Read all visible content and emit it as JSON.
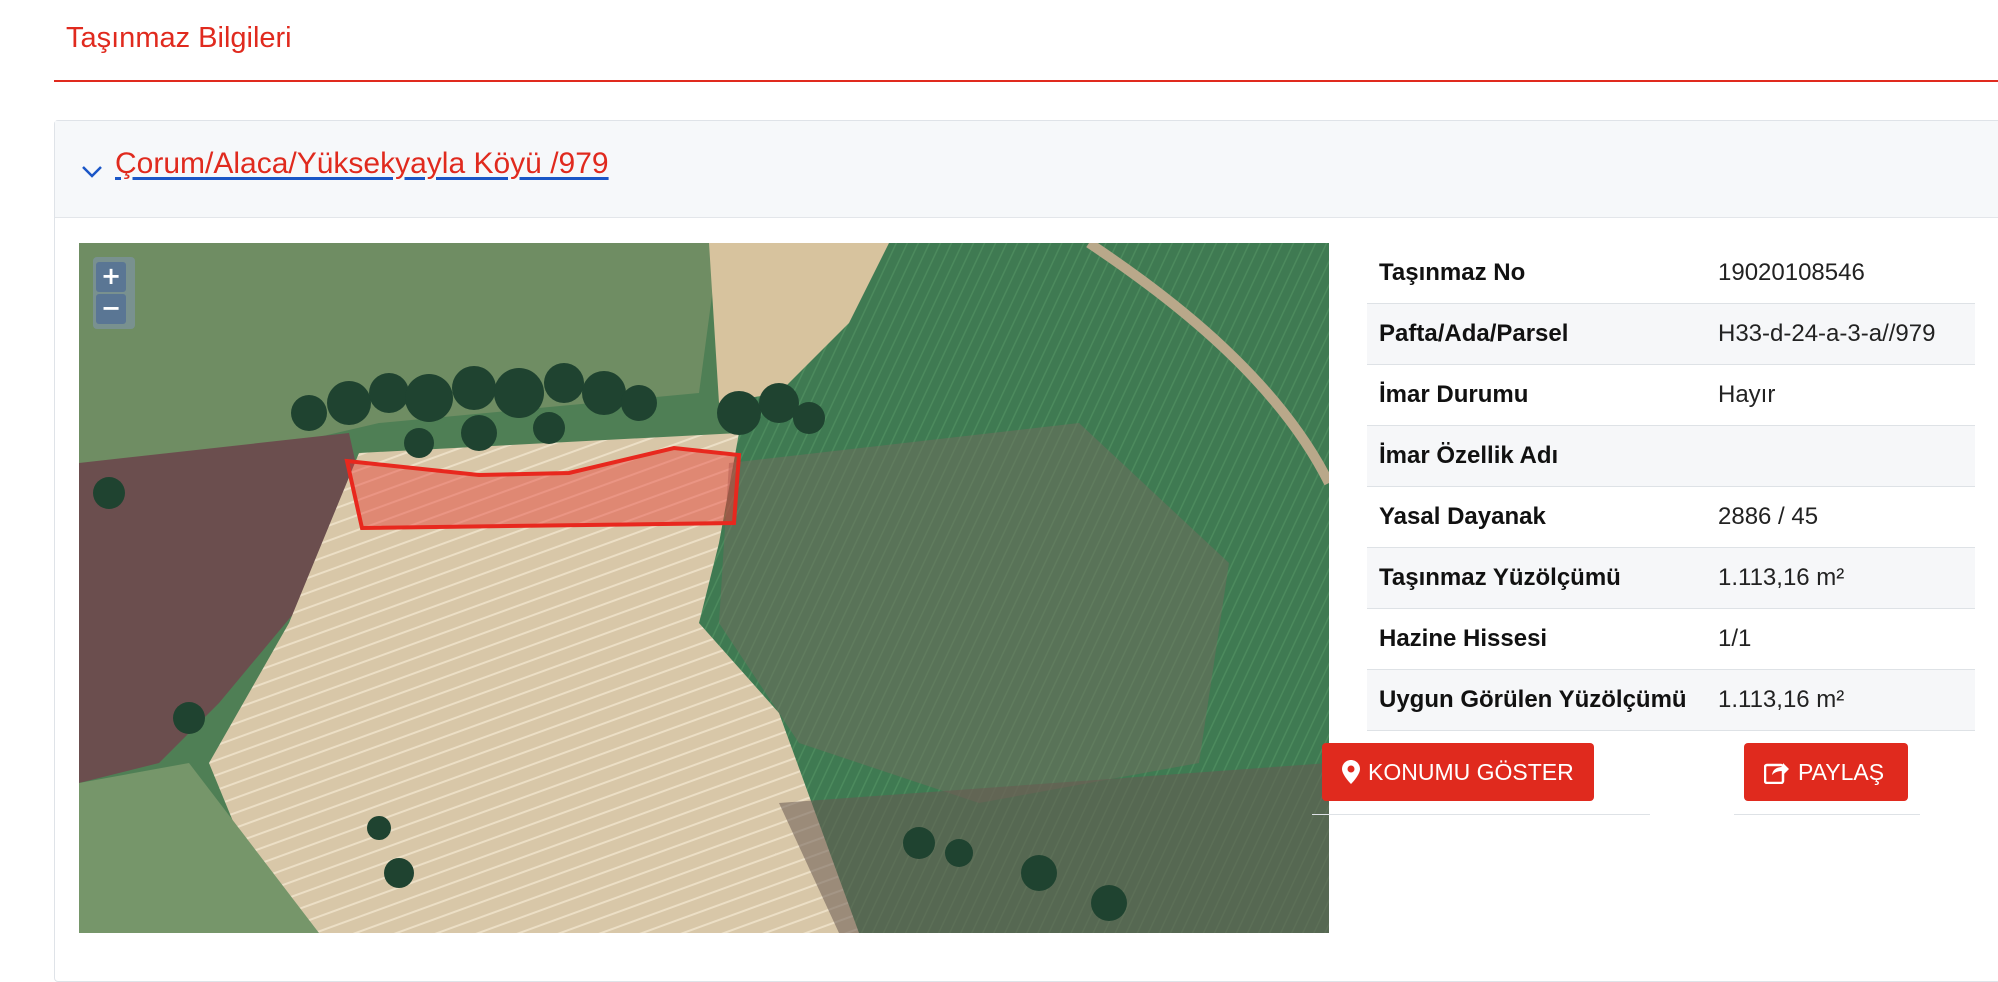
{
  "page": {
    "title": "Taşınmaz Bilgileri"
  },
  "card": {
    "title": "Çorum/Alaca/Yüksekyayla Köyü /979"
  },
  "map": {
    "zoom_in": "+",
    "zoom_out": "−"
  },
  "details": [
    {
      "label": "Taşınmaz No",
      "value": "19020108546"
    },
    {
      "label": "Pafta/Ada/Parsel",
      "value": "H33-d-24-a-3-a//979"
    },
    {
      "label": "İmar Durumu",
      "value": "Hayır"
    },
    {
      "label": "İmar Özellik Adı",
      "value": ""
    },
    {
      "label": "Yasal Dayanak",
      "value": "2886 / 45"
    },
    {
      "label": "Taşınmaz Yüzölçümü",
      "value": "1.113,16 m²"
    },
    {
      "label": "Hazine Hissesi",
      "value": "1/1"
    },
    {
      "label": "Uygun Görülen Yüzölçümü",
      "value": "1.113,16 m²"
    }
  ],
  "buttons": {
    "show_location": "KONUMU GÖSTER",
    "share": "PAYLAŞ"
  },
  "icons": {
    "chevron": "chevron-down-icon",
    "location": "map-marker-icon",
    "share": "share-icon"
  },
  "colors": {
    "accent": "#e02a1e",
    "link_underline": "#1a56c7",
    "parcel": "#e8281e"
  }
}
